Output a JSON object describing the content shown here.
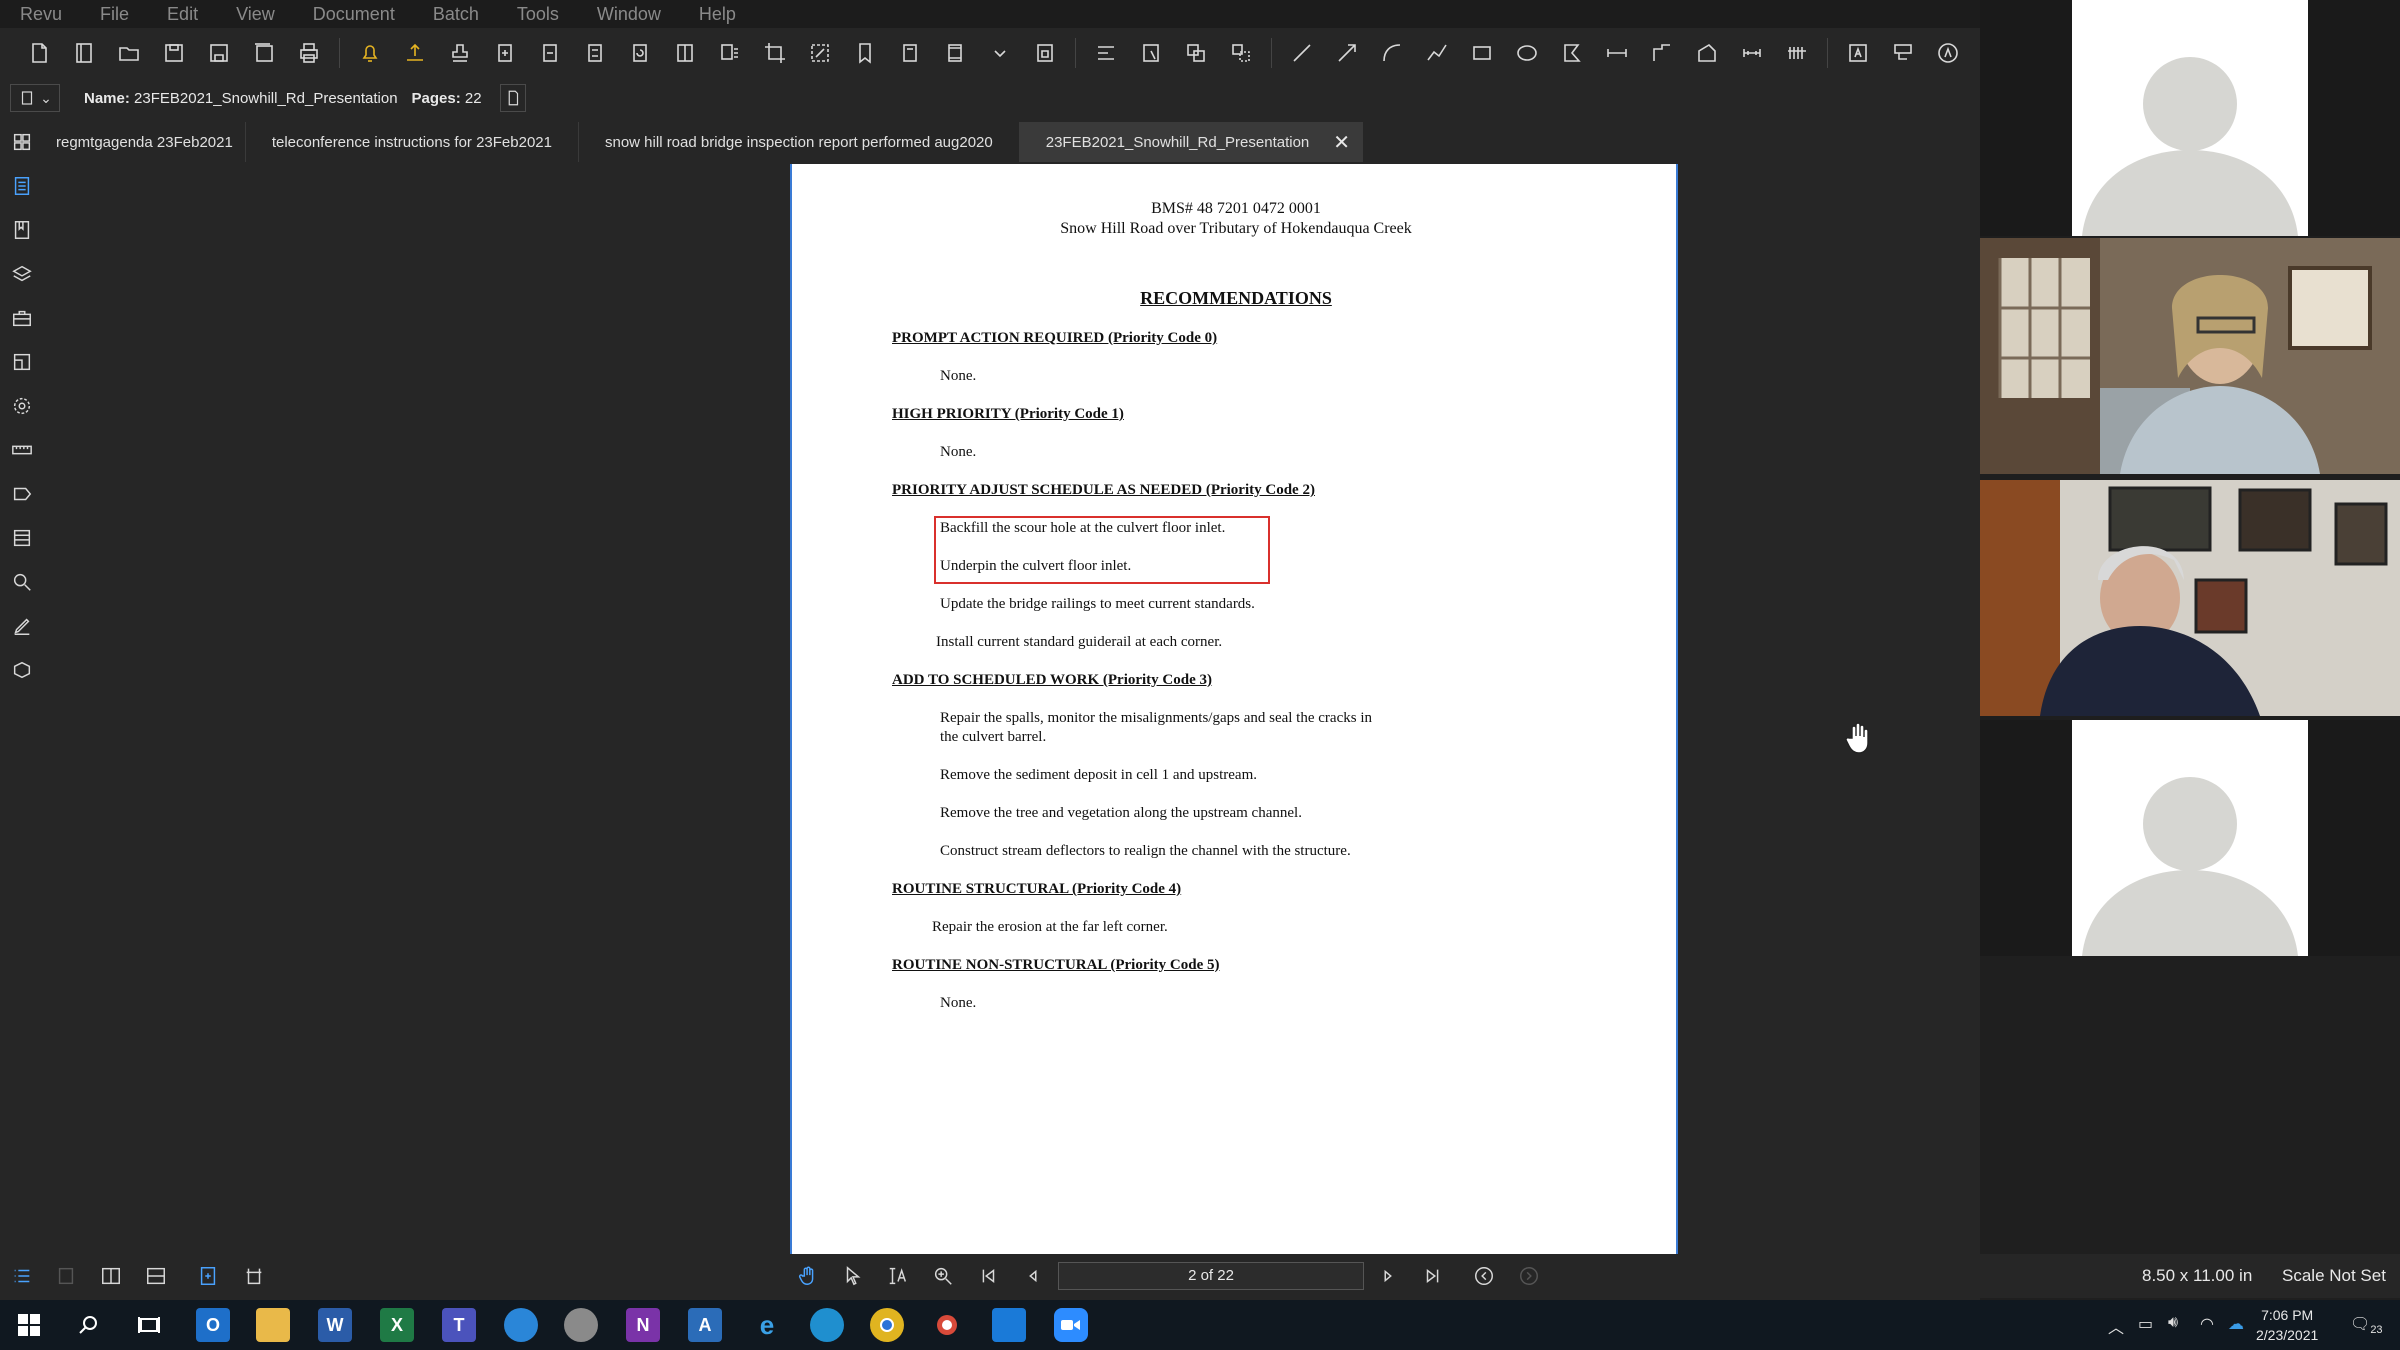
{
  "menu": [
    "Revu",
    "File",
    "Edit",
    "View",
    "Document",
    "Batch",
    "Tools",
    "Window",
    "Help"
  ],
  "docinfo": {
    "name_label": "Name:",
    "name_value": "23FEB2021_Snowhill_Rd_Presentation",
    "pages_label": "Pages:",
    "pages_value": "22"
  },
  "tabs": [
    {
      "label": "regmtgagenda 23Feb2021"
    },
    {
      "label": "teleconference instructions for 23Feb2021"
    },
    {
      "label": "snow hill road bridge inspection report performed aug2020"
    },
    {
      "label": "23FEB2021_Snowhill_Rd_Presentation",
      "active": true
    }
  ],
  "document": {
    "header_line1": "BMS# 48 7201 0472 0001",
    "header_line2": "Snow Hill Road over Tributary of Hokendauqua Creek",
    "title": "RECOMMENDATIONS",
    "sections": [
      {
        "heading": "PROMPT ACTION REQUIRED (Priority Code 0)",
        "items": [
          "None."
        ]
      },
      {
        "heading": "HIGH PRIORITY (Priority Code 1)",
        "items": [
          "None."
        ]
      },
      {
        "heading": "PRIORITY ADJUST SCHEDULE AS NEEDED (Priority Code 2)",
        "items": [
          "Backfill the scour hole at the culvert floor inlet.",
          "Underpin the culvert floor inlet.",
          "Update the bridge railings to meet current standards.",
          "Install current standard guiderail at each corner."
        ]
      },
      {
        "heading": "ADD TO SCHEDULED WORK (Priority Code 3)",
        "items": [
          "Repair the spalls, monitor the misalignments/gaps and seal the cracks in",
          "the culvert barrel.",
          "Remove the sediment deposit in cell 1 and upstream.",
          "Remove the tree and vegetation along the upstream channel.",
          "Construct stream deflectors to realign the channel with the structure."
        ]
      },
      {
        "heading": "ROUTINE STRUCTURAL (Priority Code 4)",
        "items": [
          "Repair the erosion at the far left corner."
        ]
      },
      {
        "heading": "ROUTINE NON-STRUCTURAL (Priority Code 5)",
        "items": [
          "None."
        ]
      }
    ]
  },
  "status": {
    "page_indicator": "2 of 22",
    "page_size": "8.50 x 11.00 in",
    "scale": "Scale Not Set"
  },
  "clock": {
    "time": "7:06 PM",
    "date": "2/23/2021"
  },
  "notifications": "23",
  "colors": {
    "accent": "#4aa3ff",
    "highlight_box": "#d9302c"
  }
}
